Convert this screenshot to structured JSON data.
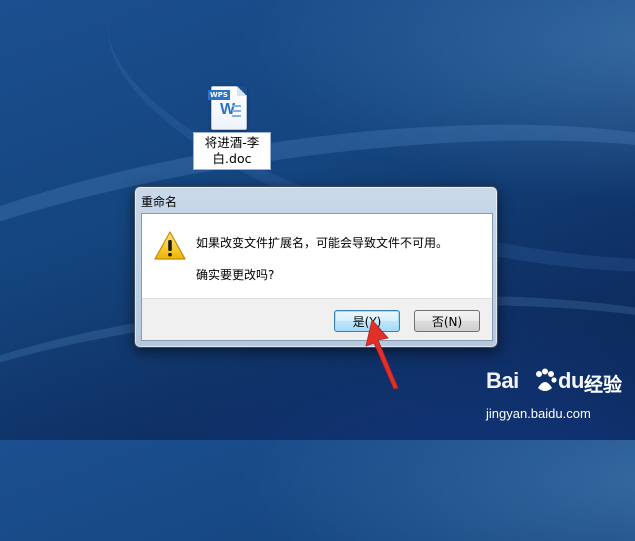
{
  "desktop": {
    "icon": {
      "name": "wps-doc-file-icon",
      "tag": "WPS",
      "letter": "W",
      "label_line1": "将进酒-李",
      "label_line2": "白.doc"
    }
  },
  "dialog": {
    "title": "重命名",
    "message": "如果改变文件扩展名，可能会导致文件不可用。",
    "question": "确实要更改吗?",
    "buttons": {
      "yes": "是(Y)",
      "no": "否(N)"
    },
    "icon": "warning-icon"
  },
  "watermark": {
    "brand_left": "Bai",
    "brand_right": "du",
    "suffix": "经验",
    "url": "jingyan.baidu.com"
  },
  "colors": {
    "accent_arrow": "#e0302a",
    "warning": "#f5c518",
    "primary_button": "#3c7fb1"
  }
}
